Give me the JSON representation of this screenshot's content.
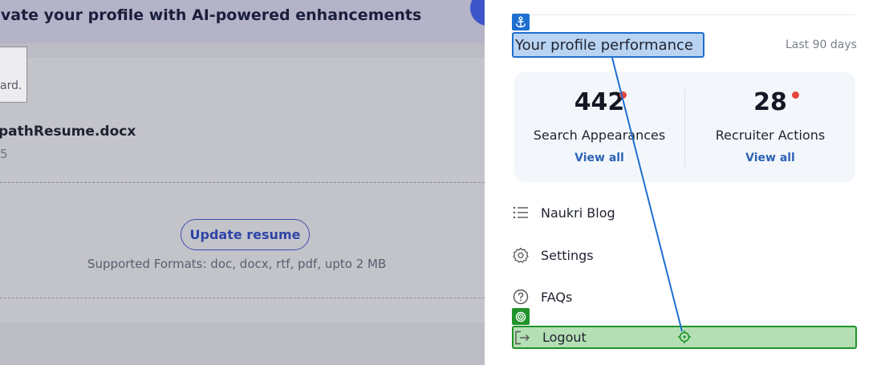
{
  "background": {
    "banner_title": "evate your profile with AI-powered enhancements",
    "tooltip_text": "ard.",
    "file_name": "pathResume.docx",
    "file_date": "5",
    "update_button": "Update resume",
    "supported_formats": "Supported Formats: doc, docx, rtf, pdf, upto 2 MB"
  },
  "drawer": {
    "performance_title": "Your profile performance",
    "period": "Last 90 days",
    "stats": [
      {
        "value": "442",
        "label": "Search Appearances",
        "link": "View all"
      },
      {
        "value": "28",
        "label": "Recruiter Actions",
        "link": "View all"
      }
    ],
    "menu": [
      {
        "label": "Naukri Blog",
        "icon": "list-icon"
      },
      {
        "label": "Settings",
        "icon": "gear-icon"
      },
      {
        "label": "FAQs",
        "icon": "question-icon"
      },
      {
        "label": "Logout",
        "icon": "logout-icon"
      }
    ]
  },
  "colors": {
    "link_blue": "#2d62b6",
    "notification_red": "#e8453c",
    "anchor_highlight": "#1e6fd0",
    "target_highlight": "#20942a"
  }
}
